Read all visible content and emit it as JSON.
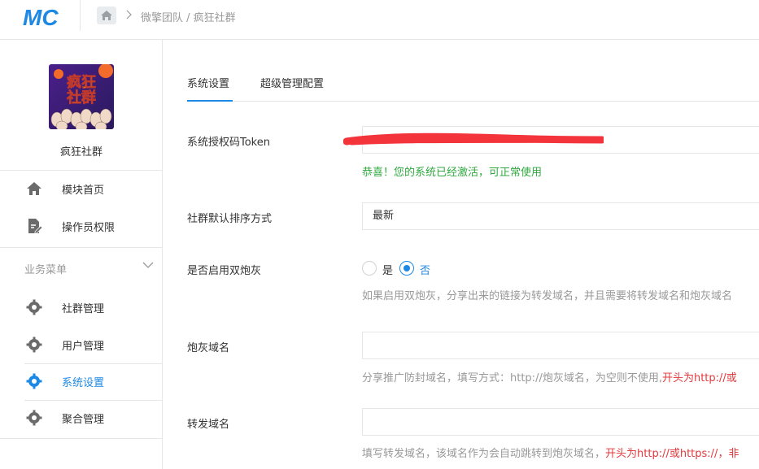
{
  "header": {
    "logo_text": "MC",
    "breadcrumb": "微擎团队 / 疯狂社群"
  },
  "sidebar": {
    "org_avatar_text_line1": "疯狂",
    "org_avatar_text_line2": "社群",
    "org_name": "疯狂社群",
    "top_items": [
      {
        "label": "模块首页",
        "icon": "home-icon"
      },
      {
        "label": "操作员权限",
        "icon": "document-edit-icon"
      }
    ],
    "group_title": "业务菜单",
    "group_items": [
      {
        "label": "社群管理",
        "icon": "gear-icon"
      },
      {
        "label": "用户管理",
        "icon": "gear-icon"
      },
      {
        "label": "系统设置",
        "icon": "gear-icon",
        "active": true
      },
      {
        "label": "聚合管理",
        "icon": "gear-icon"
      }
    ]
  },
  "tabs": [
    {
      "label": "系统设置",
      "active": true
    },
    {
      "label": "超级管理配置",
      "active": false
    }
  ],
  "form": {
    "token_label": "系统授权码Token",
    "token_value": "",
    "token_success": "恭喜！您的系统已经激活，可正常使用",
    "sort_label": "社群默认排序方式",
    "sort_value": "最新",
    "dual_label": "是否启用双炮灰",
    "dual_yes": "是",
    "dual_no": "否",
    "dual_selected": "否",
    "dual_help": "如果启用双炮灰，分享出来的链接为转发域名，并且需要将转发域名和炮灰域名",
    "cannon_label": "炮灰域名",
    "cannon_help_plain": "分享推广防封域名，填写方式：http://炮灰域名，为空则不使用,",
    "cannon_help_red": "开头为http://或",
    "forward_label": "转发域名",
    "forward_help_plain": "填写转发域名，该域名作为会自动跳转到炮灰域名，",
    "forward_help_red": "开头为http://或https://，非"
  },
  "colors": {
    "accent": "#1e88e5",
    "success": "#2fa83f",
    "warning": "#e4393c",
    "redact": "#f4343b"
  }
}
